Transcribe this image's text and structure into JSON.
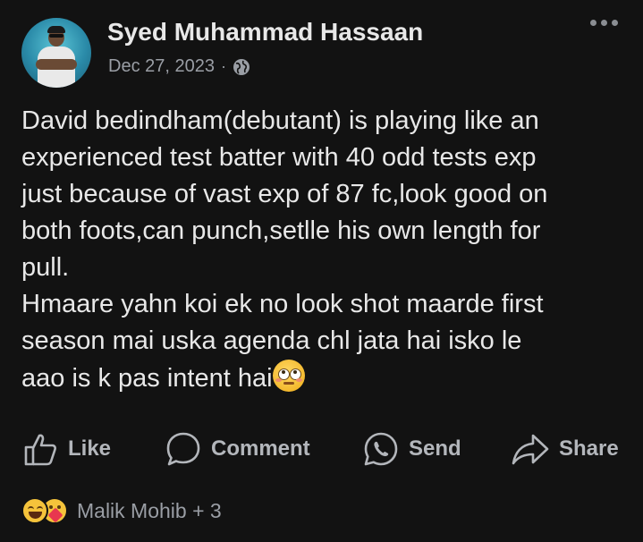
{
  "post": {
    "author": "Syed Muhammad Hassaan",
    "date": "Dec 27, 2023",
    "separator": "·",
    "privacy_icon": "globe-icon",
    "text": "David bedindham(debutant) is playing like an\nexperienced test batter with 40 odd tests exp\njust because of vast exp of 87 fc,look good on\nboth foots,can punch,setlle his own length for\npull.\nHmaare yahn koi ek no look shot maarde first\nseason mai uska agenda chl jata hai isko le\naao is k pas intent hai",
    "trailing_emoji": "face-with-rolling-eyes-emoji"
  },
  "actions": {
    "like": "Like",
    "comment": "Comment",
    "send": "Send",
    "share": "Share"
  },
  "reactions": {
    "icons": [
      "laughing-reaction-icon",
      "care-reaction-icon"
    ],
    "summary": "Malik Mohib + 3"
  },
  "colors": {
    "background": "#121212",
    "text": "#e8e8e8",
    "muted": "#9a9ea5"
  }
}
